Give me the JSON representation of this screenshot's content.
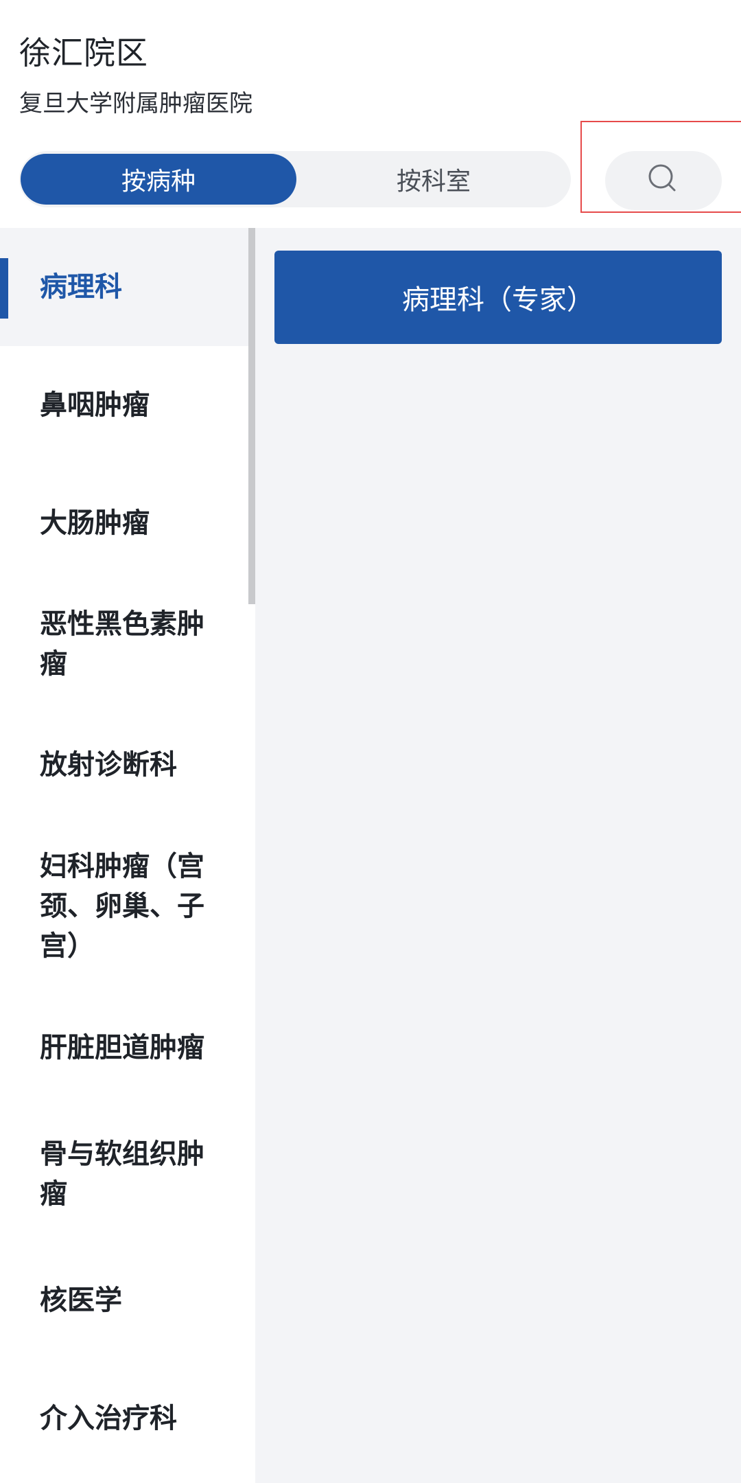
{
  "header": {
    "campus": "徐汇院区",
    "hospital": "复旦大学附属肿瘤医院"
  },
  "tabs": {
    "by_disease": "按病种",
    "by_department": "按科室"
  },
  "search": {
    "icon": "search-icon"
  },
  "sidebar": {
    "items": [
      {
        "label": "病理科"
      },
      {
        "label": "鼻咽肿瘤"
      },
      {
        "label": "大肠肿瘤"
      },
      {
        "label": "恶性黑色素肿瘤"
      },
      {
        "label": "放射诊断科"
      },
      {
        "label": "妇科肿瘤（宫颈、卵巢、子宫）"
      },
      {
        "label": "肝脏胆道肿瘤"
      },
      {
        "label": "骨与软组织肿瘤"
      },
      {
        "label": "核医学"
      },
      {
        "label": "介入治疗科"
      }
    ]
  },
  "departments": [
    {
      "label": "病理科（专家）"
    }
  ],
  "colors": {
    "primary": "#1f57a8",
    "highlight": "#e64a4a",
    "panel_bg": "#f3f4f7"
  }
}
